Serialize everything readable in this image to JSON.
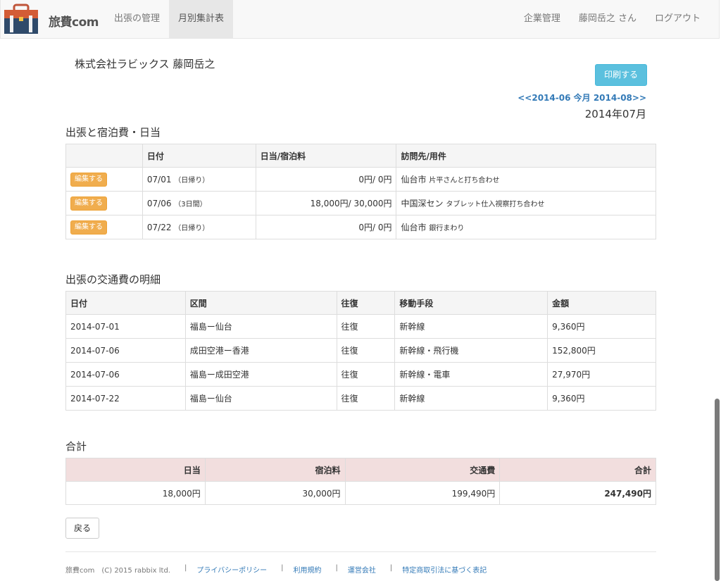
{
  "nav": {
    "brand": "旅費com",
    "left_items": [
      {
        "label": "出張の管理",
        "active": false
      },
      {
        "label": "月別集計表",
        "active": true
      }
    ],
    "right_items": [
      {
        "label": "企業管理"
      },
      {
        "label": "藤岡岳之 さん"
      },
      {
        "label": "ログアウト"
      }
    ]
  },
  "header": {
    "company_user": "株式会社ラビックス 藤岡岳之",
    "print_label": "印刷する",
    "prev_month": "<<2014-06",
    "this_month": "今月",
    "next_month": "2014-08>>",
    "month_title": "2014年07月"
  },
  "trips": {
    "title": "出張と宿泊費・日当",
    "headers": [
      "",
      "日付",
      "日当/宿泊料",
      "訪問先/用件"
    ],
    "edit_label": "編集する",
    "rows": [
      {
        "date": "07/01",
        "duration": "（日帰り）",
        "amount": "0円/ 0円",
        "place": "仙台市",
        "purpose": "片平さんと打ち合わせ"
      },
      {
        "date": "07/06",
        "duration": "（3日間）",
        "amount": "18,000円/ 30,000円",
        "place": "中国深セン",
        "purpose": "タブレット仕入視察打ち合わせ"
      },
      {
        "date": "07/22",
        "duration": "（日帰り）",
        "amount": "0円/ 0円",
        "place": "仙台市",
        "purpose": "銀行まわり"
      }
    ]
  },
  "transport": {
    "title": "出張の交通費の明細",
    "headers": [
      "日付",
      "区間",
      "往復",
      "移動手段",
      "金額"
    ],
    "rows": [
      [
        "2014-07-01",
        "福島ー仙台",
        "往復",
        "新幹線",
        "9,360円"
      ],
      [
        "2014-07-06",
        "成田空港ー香港",
        "往復",
        "新幹線・飛行機",
        "152,800円"
      ],
      [
        "2014-07-06",
        "福島ー成田空港",
        "往復",
        "新幹線・電車",
        "27,970円"
      ],
      [
        "2014-07-22",
        "福島ー仙台",
        "往復",
        "新幹線",
        "9,360円"
      ]
    ]
  },
  "total": {
    "title": "合計",
    "headers": [
      "日当",
      "宿泊料",
      "交通費",
      "合計"
    ],
    "values": [
      "18,000円",
      "30,000円",
      "199,490円",
      "247,490円"
    ]
  },
  "back_label": "戻る",
  "footer": {
    "copyright": "旅費com　(C) 2015 rabbix ltd.",
    "separator": "|",
    "links": [
      "プライバシーポリシー",
      "利用規約",
      "運営会社",
      "特定商取引法に基づく表記"
    ]
  },
  "colors": {
    "info": "#5bc0de",
    "warning": "#f0ad4e",
    "danger_bg": "#f2dede",
    "link": "#337ab7"
  }
}
